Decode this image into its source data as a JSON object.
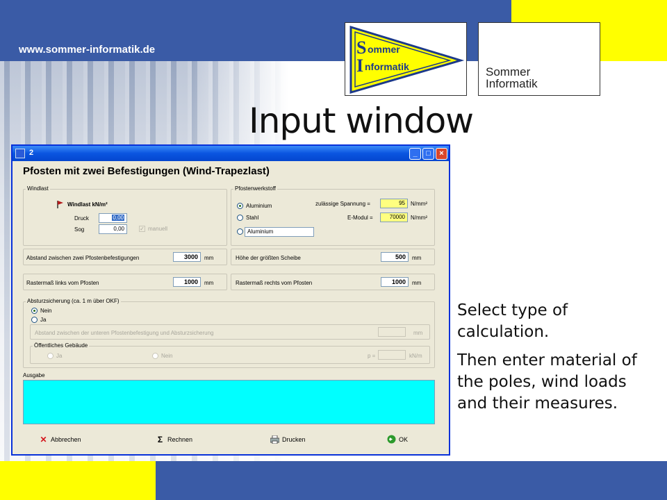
{
  "slide": {
    "url": "www.sommer-informatik.de",
    "logo_text": [
      "Sommer",
      "Informatik"
    ],
    "title": "Input window",
    "side_text": [
      "Select type of calculation.",
      "Then enter material of the poles, wind loads and their measures."
    ]
  },
  "window": {
    "title": "2",
    "heading": "Pfosten mit zwei Befestigungen (Wind-Trapezlast)",
    "windlast": {
      "group_label": "Windlast",
      "header": "Windlast kN/m²",
      "druck_label": "Druck",
      "druck_value": "0,00",
      "sog_label": "Sog",
      "sog_value": "0,00",
      "manuell_label": "manuell",
      "manuell_checked": true
    },
    "material": {
      "group_label": "Pfostenwerkstoff",
      "options": [
        "Aluminium",
        "Stahl"
      ],
      "selected": "Aluminium",
      "custom_value": "Aluminium",
      "spannung_label": "zulässige Spannung =",
      "spannung_value": "95",
      "spannung_unit": "N/mm²",
      "emodul_label": "E-Modul =",
      "emodul_value": "70000",
      "emodul_unit": "N/mm²"
    },
    "abstand": {
      "label": "Abstand zwischen zwei Pfostenbefestigungen",
      "value": "3000",
      "unit": "mm"
    },
    "hoehe": {
      "label": "Höhe der größten Scheibe",
      "value": "500",
      "unit": "mm"
    },
    "raster_links": {
      "label": "Rastermaß links vom Pfosten",
      "value": "1000",
      "unit": "mm"
    },
    "raster_rechts": {
      "label": "Rastermaß rechts vom Pfosten",
      "value": "1000",
      "unit": "mm"
    },
    "absturz": {
      "group_label": "Absturzsicherung (ca. 1 m über OKF)",
      "options": [
        "Nein",
        "Ja"
      ],
      "selected": "Nein",
      "abstand_label": "Abstand zwischen der unteren Pfostenbefestigung und Absturzsicherung",
      "abstand_unit": "mm",
      "gebaeude_label": "Öffentliches Gebäude",
      "gebaeude_options": [
        "Ja",
        "Nein"
      ],
      "p_label": "p =",
      "p_unit": "kN/m"
    },
    "ausgabe_label": "Ausgabe",
    "buttons": {
      "abbrechen": "Abbrechen",
      "rechnen": "Rechnen",
      "drucken": "Drucken",
      "ok": "OK"
    }
  },
  "colors": {
    "slide_blue": "#3a5ba6",
    "slide_yellow": "#ffff00",
    "output_bg": "#00ffff",
    "titlebar": "#0a55e0"
  }
}
